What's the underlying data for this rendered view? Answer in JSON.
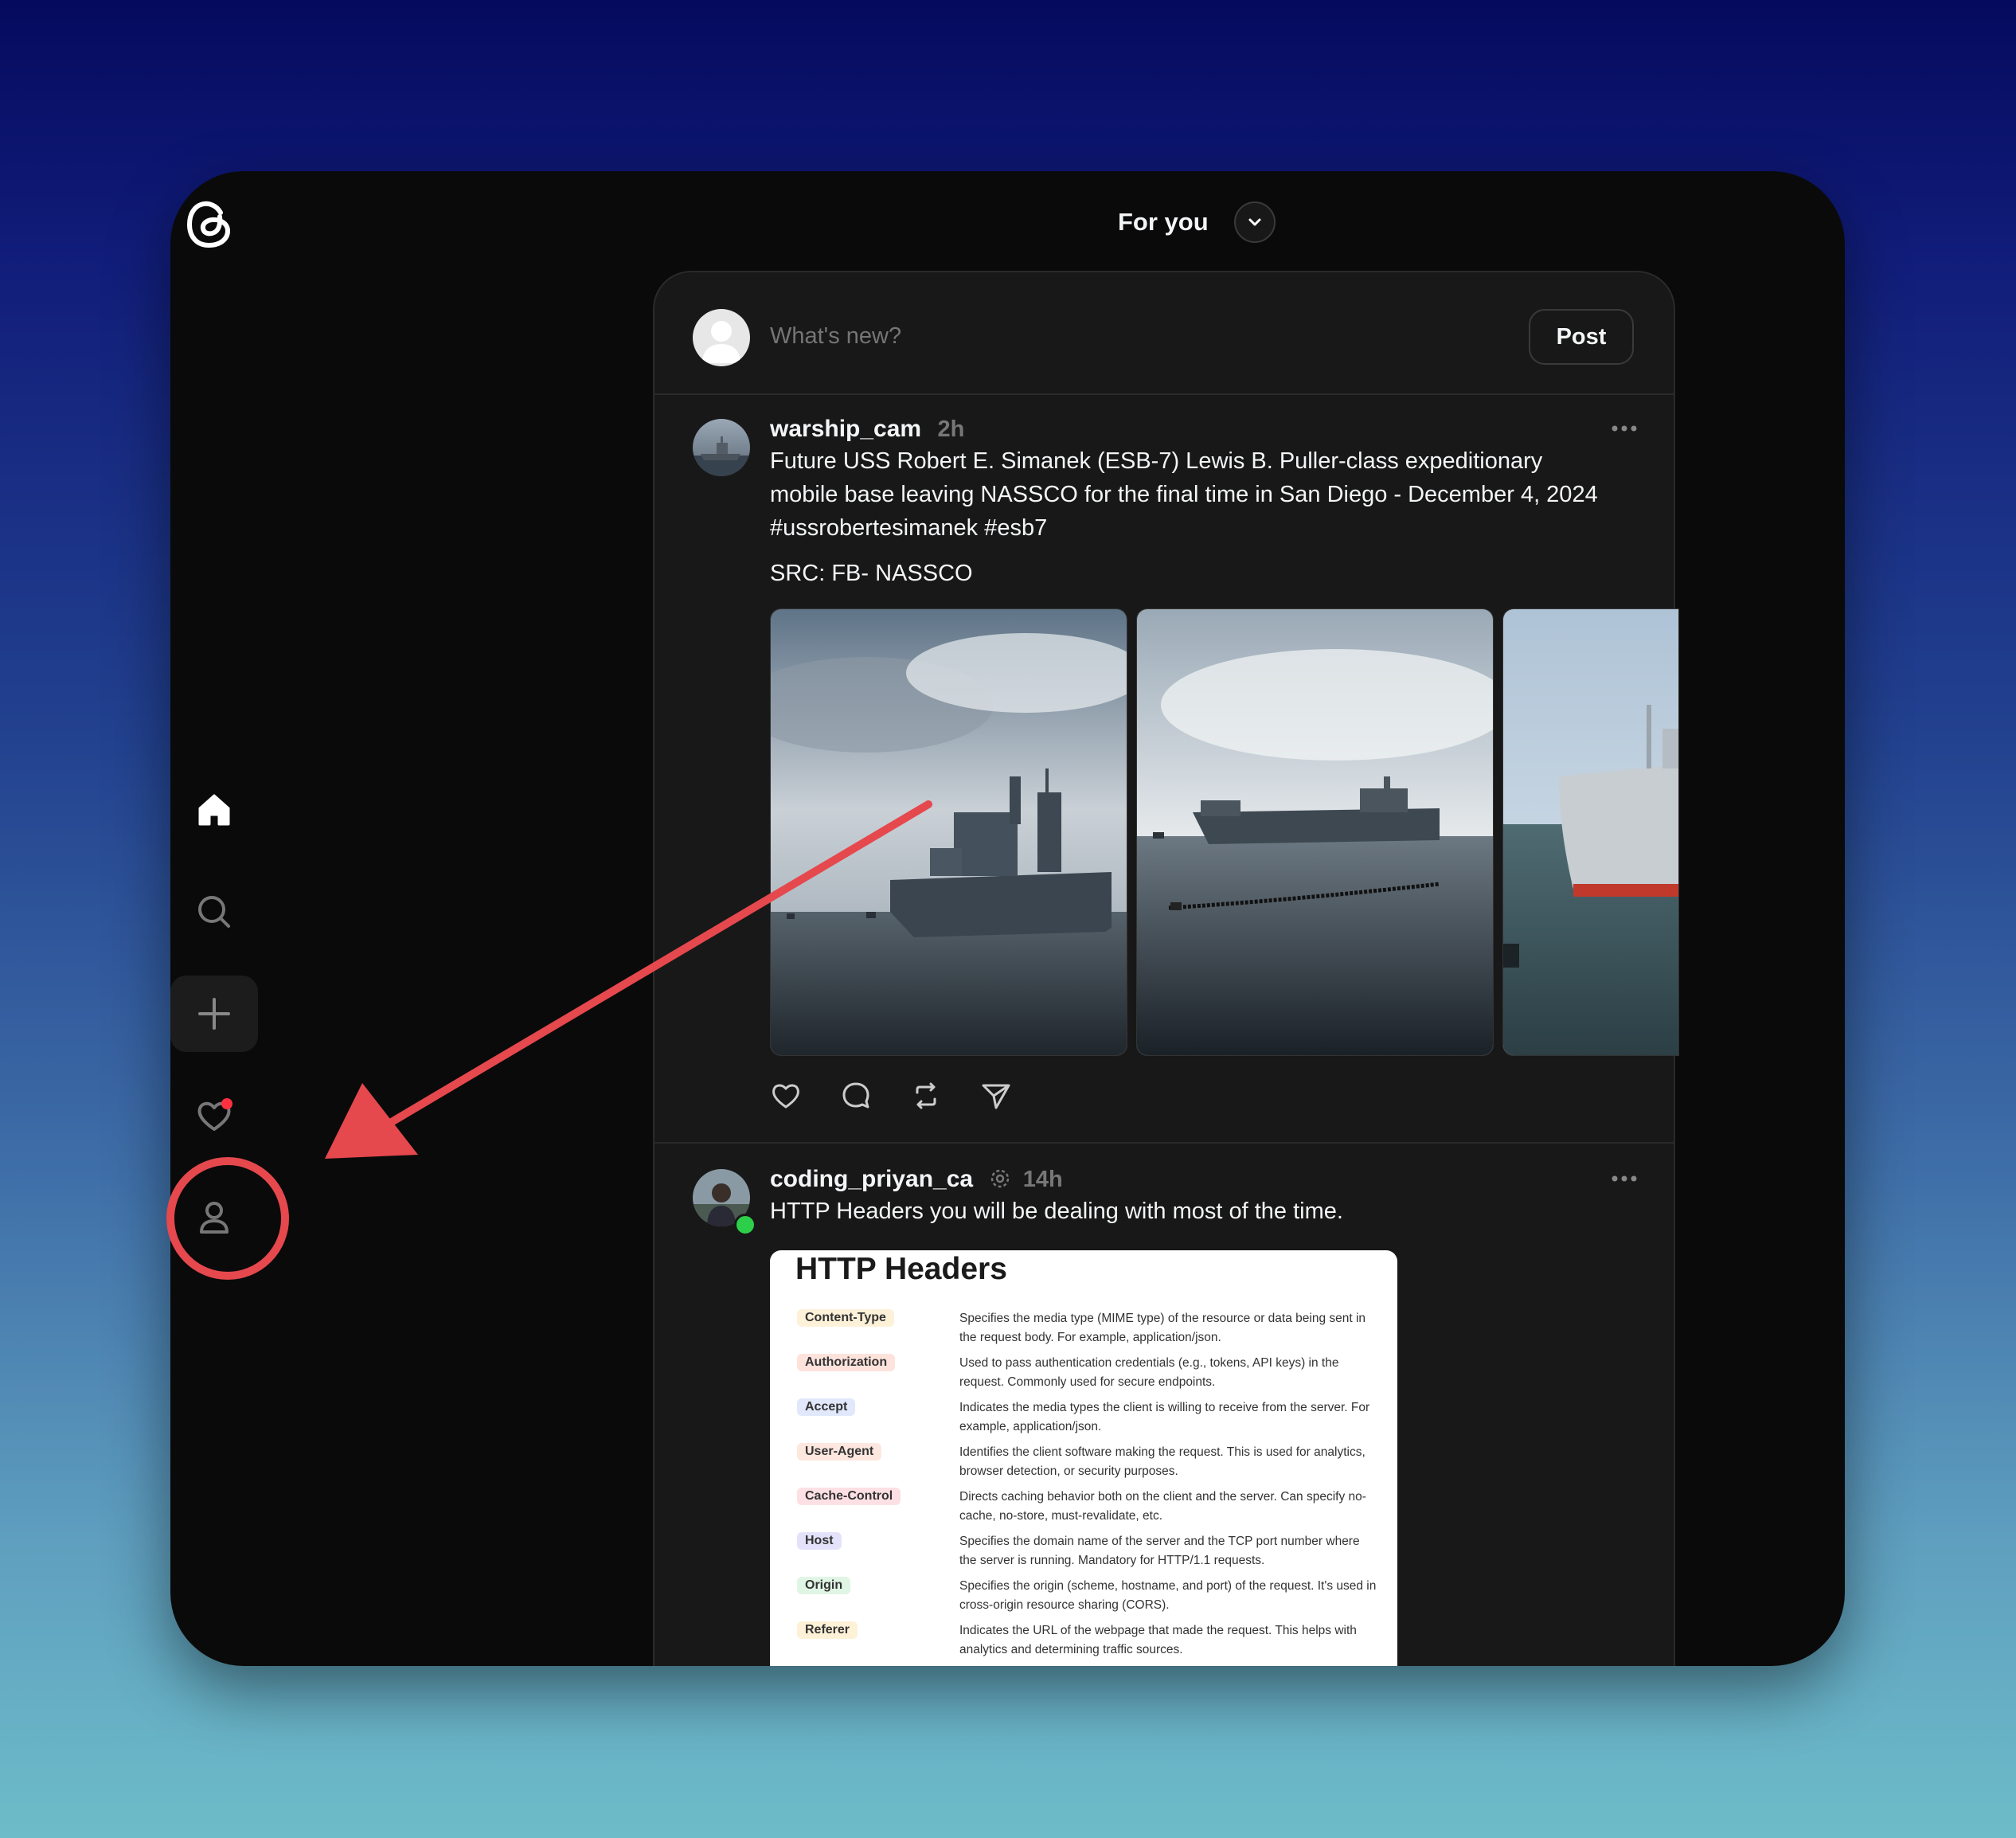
{
  "app": {
    "name": "Threads"
  },
  "header": {
    "feed_title": "For you"
  },
  "composer": {
    "placeholder": "What's new?",
    "post_label": "Post"
  },
  "sidebar": {
    "items": [
      "home-icon",
      "search-icon",
      "plus-icon",
      "heart-icon",
      "person-icon"
    ]
  },
  "posts": [
    {
      "username": "warship_cam",
      "time": "2h",
      "text": "Future USS Robert E. Simanek (ESB-7) Lewis B. Puller-class expeditionary mobile base leaving NASSCO for the final time in San Diego - December 4, 2024 #ussrobertesimanek #esb7",
      "src_line": "SRC: FB- NASSCO"
    },
    {
      "username": "coding_priyan_ca",
      "time": "14h",
      "text": "HTTP Headers you will be dealing with most of the time."
    }
  ],
  "http_card": {
    "title": "HTTP Headers",
    "rows": [
      {
        "name": "Content-Type",
        "desc": "Specifies the media type (MIME type) of the resource or data being sent in the request body. For example, application/json."
      },
      {
        "name": "Authorization",
        "desc": "Used to pass authentication credentials (e.g., tokens, API keys) in the request. Commonly used for secure endpoints."
      },
      {
        "name": "Accept",
        "desc": "Indicates the media types the client is willing to receive from the server. For example, application/json."
      },
      {
        "name": "User-Agent",
        "desc": "Identifies the client software making the request. This is used for analytics, browser detection, or security purposes."
      },
      {
        "name": "Cache-Control",
        "desc": "Directs caching behavior both on the client and the server. Can specify no-cache, no-store, must-revalidate, etc."
      },
      {
        "name": "Host",
        "desc": "Specifies the domain name of the server and the TCP port number where the server is running. Mandatory for HTTP/1.1 requests."
      },
      {
        "name": "Origin",
        "desc": "Specifies the origin (scheme, hostname, and port) of the request. It's used in cross-origin resource sharing (CORS)."
      },
      {
        "name": "Referer",
        "desc": "Indicates the URL of the webpage that made the request. This helps with analytics and determining traffic sources."
      }
    ]
  },
  "colors": {
    "annotation": "#e5484d",
    "notification_dot": "#ff3040",
    "online": "#2dcf4a",
    "window": "#0a0a0a",
    "feed": "#181818"
  }
}
